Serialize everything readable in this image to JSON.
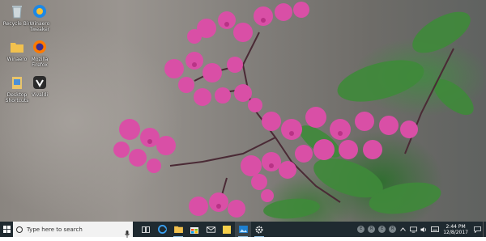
{
  "desktop": {
    "icons": [
      {
        "label": "Recycle Bin",
        "icon": "recycle-bin-icon"
      },
      {
        "label": "Winaero Tweaker",
        "icon": "winaero-tweaker-icon"
      },
      {
        "label": "Winaero",
        "icon": "folder-icon"
      },
      {
        "label": "Mozilla Firefox",
        "icon": "firefox-icon"
      },
      {
        "label": "Desktop Shortcuts",
        "icon": "shortcut-folder-icon"
      },
      {
        "label": "Vivaldi",
        "icon": "vivaldi-icon"
      }
    ]
  },
  "taskbar": {
    "search_placeholder": "Type here to search",
    "pinned": [
      {
        "icon": "task-view-icon"
      },
      {
        "icon": "edge-icon"
      },
      {
        "icon": "file-explorer-icon"
      },
      {
        "icon": "store-icon"
      },
      {
        "icon": "mail-icon"
      },
      {
        "icon": "sticky-notes-icon"
      },
      {
        "icon": "photos-icon"
      },
      {
        "icon": "settings-icon"
      }
    ],
    "tray_buttons": [
      "E",
      "R",
      "E",
      "R"
    ],
    "clock": {
      "time": "2:44 PM",
      "date": "12/8/2017"
    }
  },
  "colors": {
    "taskbar_bg": "#1f2a30",
    "search_bg": "#f2f2f2",
    "flower_pink": "#d94fa6",
    "flower_dark": "#b02c7e",
    "leaf_green": "#3f8a3a"
  }
}
